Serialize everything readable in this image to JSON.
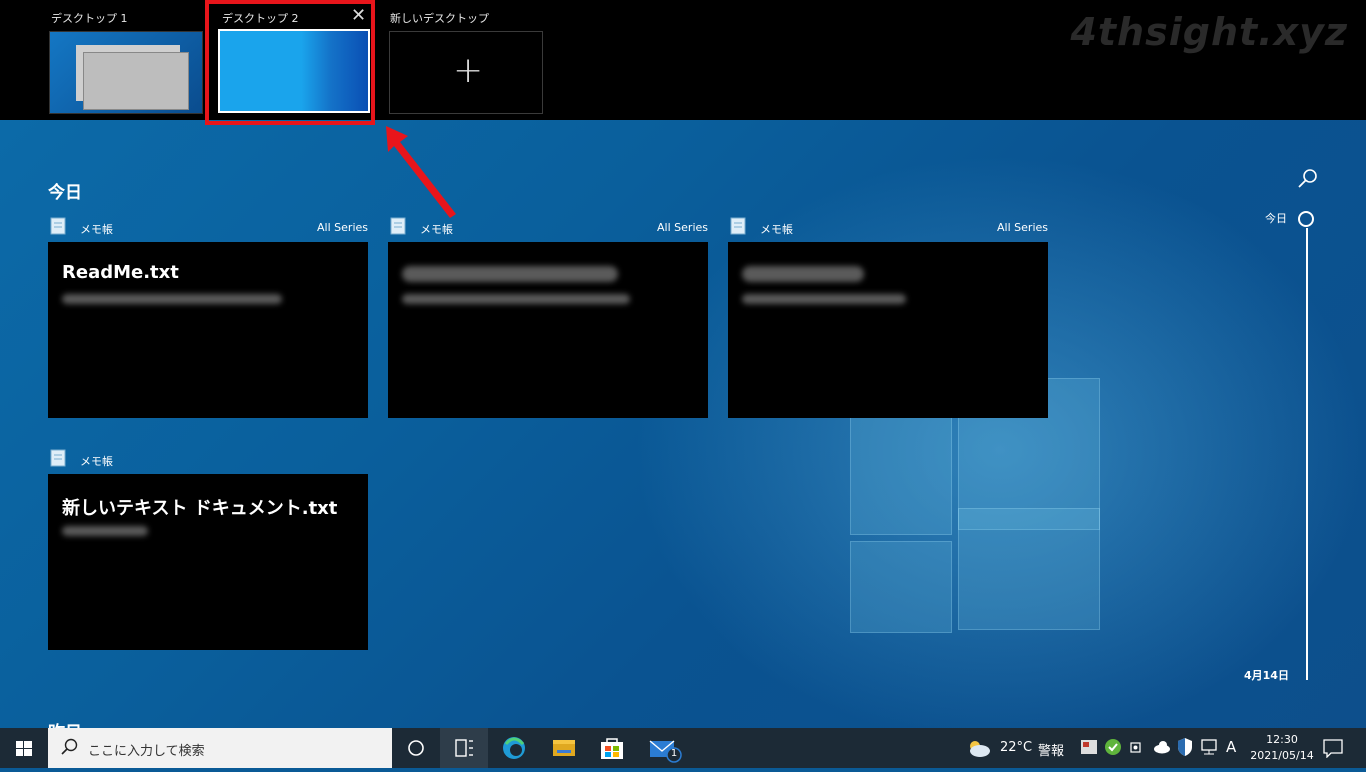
{
  "watermark": "4thsight.xyz",
  "desktops": [
    {
      "label": "デスクトップ 1"
    },
    {
      "label": "デスクトップ 2"
    },
    {
      "label": "新しいデスクトップ"
    }
  ],
  "timeline": {
    "today_heading": "今日",
    "yesterday_heading": "昨日",
    "scrubber_top": "今日",
    "scrubber_bottom": "4月14日",
    "cards": [
      {
        "app": "メモ帳",
        "series": "All Series",
        "title": "ReadMe.txt"
      },
      {
        "app": "メモ帳",
        "series": "All Series",
        "title": ""
      },
      {
        "app": "メモ帳",
        "series": "All Series",
        "title": ""
      },
      {
        "app": "メモ帳",
        "series": "",
        "title": "新しいテキスト ドキュメント.txt"
      }
    ]
  },
  "taskbar": {
    "search_placeholder": "ここに入力して検索",
    "temperature": "22°C",
    "weather_alert": "警報",
    "ime": "A",
    "time": "12:30",
    "date": "2021/05/14",
    "mail_badge": "1"
  },
  "colors": {
    "highlight": "#e8151b",
    "taskbar": "#1c2a36",
    "wallpaper": "#0a5a96"
  }
}
